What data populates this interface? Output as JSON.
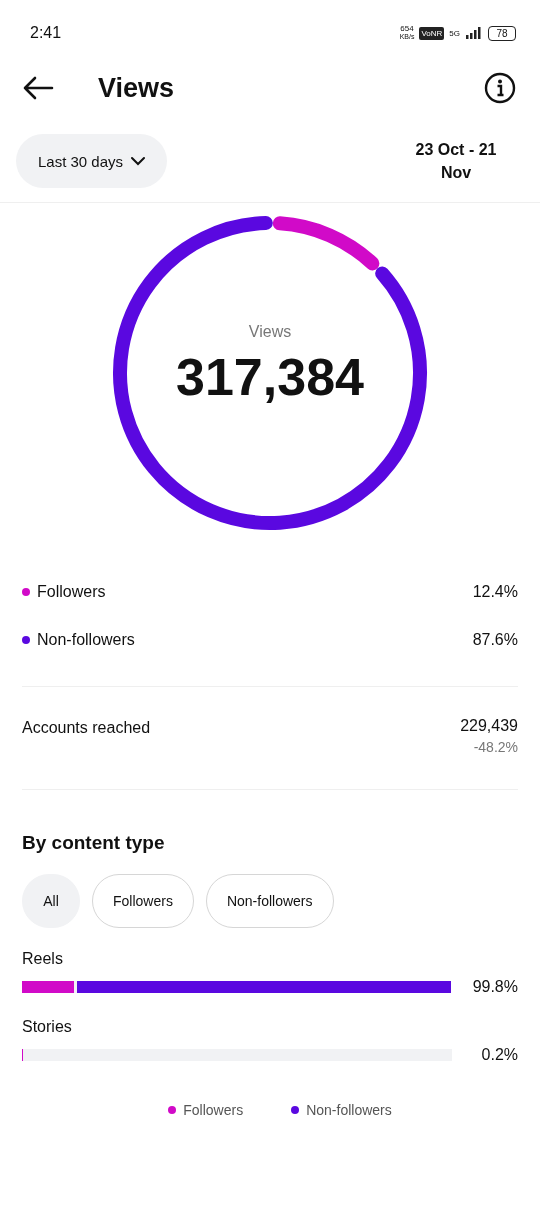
{
  "status_bar": {
    "time": "2:41",
    "speed": "654",
    "speed_unit": "KB/s",
    "badge": "VoNR",
    "network": "5G",
    "battery": "78"
  },
  "header": {
    "title": "Views"
  },
  "filter": {
    "label": "Last 30 days",
    "date_range": "23 Oct - 21 Nov"
  },
  "summary": {
    "label": "Views",
    "total": "317,384"
  },
  "breakdown": [
    {
      "label": "Followers",
      "value": "12.4%",
      "color": "#d10ac8"
    },
    {
      "label": "Non-followers",
      "value": "87.6%",
      "color": "#5a08e0"
    }
  ],
  "accounts_reached": {
    "label": "Accounts reached",
    "value": "229,439",
    "change": "-48.2%"
  },
  "content_type": {
    "title": "By content type",
    "chips": [
      {
        "label": "All",
        "selected": true
      },
      {
        "label": "Followers",
        "selected": false
      },
      {
        "label": "Non-followers",
        "selected": false
      }
    ],
    "rows": [
      {
        "label": "Reels",
        "value": "99.8%",
        "segments": [
          {
            "level": 0.122,
            "color": "#d10ac8"
          },
          {
            "level": 0.878,
            "color": "#5a08e0"
          }
        ]
      },
      {
        "label": "Stories",
        "value": "0.2%",
        "segments": [
          {
            "level": 0.003,
            "color": "#d10ac8"
          }
        ]
      }
    ],
    "legend": [
      {
        "label": "Followers",
        "color": "#d10ac8"
      },
      {
        "label": "Non-followers",
        "color": "#5a08e0"
      }
    ]
  }
}
